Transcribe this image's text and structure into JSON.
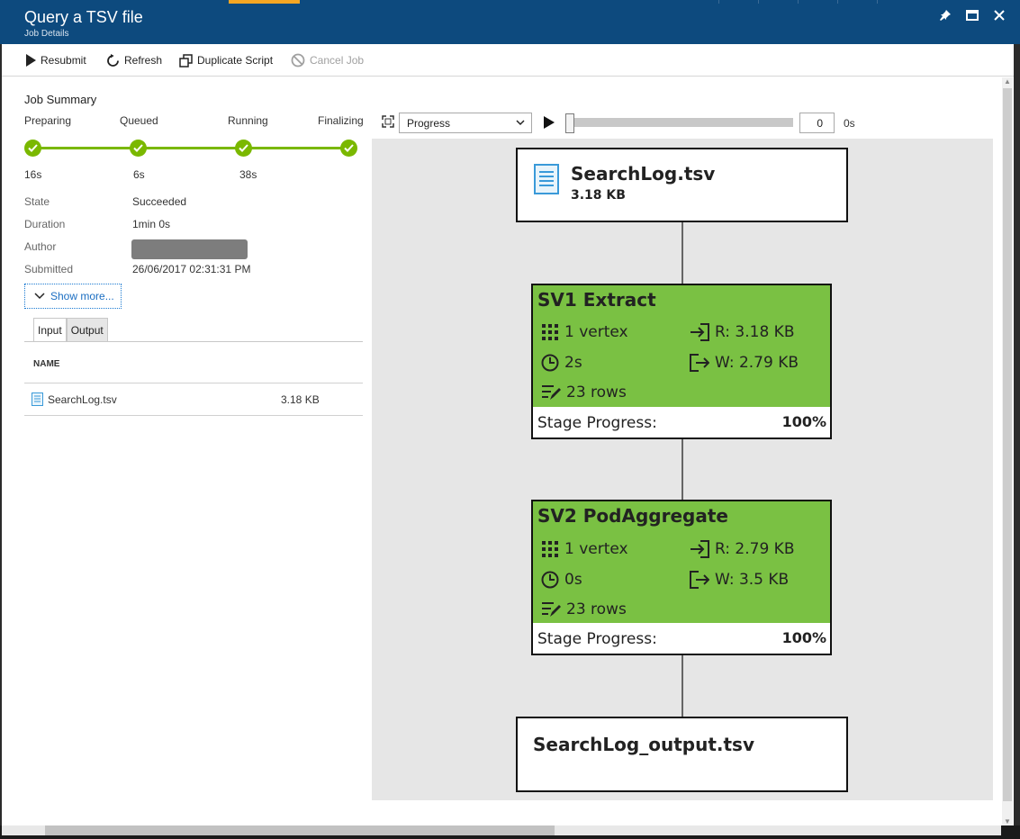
{
  "window": {
    "title": "Query a TSV file",
    "subtitle": "Job Details"
  },
  "toolbar": {
    "resubmit": "Resubmit",
    "refresh": "Refresh",
    "duplicate": "Duplicate Script",
    "cancel": "Cancel Job"
  },
  "summary": {
    "heading": "Job Summary",
    "stages": [
      {
        "label": "Preparing",
        "time": "16s"
      },
      {
        "label": "Queued",
        "time": "6s"
      },
      {
        "label": "Running",
        "time": "38s"
      },
      {
        "label": "Finalizing",
        "time": ""
      }
    ],
    "details": [
      {
        "key": "State",
        "value": "Succeeded"
      },
      {
        "key": "Duration",
        "value": "1min 0s"
      },
      {
        "key": "Author",
        "value": ""
      },
      {
        "key": "Submitted",
        "value": "26/06/2017 02:31:31 PM"
      }
    ],
    "show_more": "Show more..."
  },
  "files": {
    "tabs": [
      "Input",
      "Output"
    ],
    "column_name": "NAME",
    "rows": [
      {
        "name": "SearchLog.tsv",
        "size": "3.18 KB"
      }
    ]
  },
  "graph": {
    "view_select": "Progress",
    "playback_value": "0",
    "playback_unit": "0s",
    "input_file": {
      "name": "SearchLog.tsv",
      "size": "3.18 KB"
    },
    "stages": [
      {
        "name": "SV1 Extract",
        "vertex": "1 vertex",
        "time": "2s",
        "rows": "23 rows",
        "read": "R: 3.18 KB",
        "write": "W: 2.79 KB",
        "progress_label": "Stage Progress:",
        "progress": "100%"
      },
      {
        "name": "SV2 PodAggregate",
        "vertex": "1 vertex",
        "time": "0s",
        "rows": "23 rows",
        "read": "R: 2.79 KB",
        "write": "W: 3.5 KB",
        "progress_label": "Stage Progress:",
        "progress": "100%"
      }
    ],
    "output_file": {
      "name": "SearchLog_output.tsv"
    }
  },
  "colors": {
    "titlebar": "#0d4a7e",
    "stage_green": "#7ac143",
    "progress_green": "#7ab800",
    "link_blue": "#1b6ec2"
  }
}
